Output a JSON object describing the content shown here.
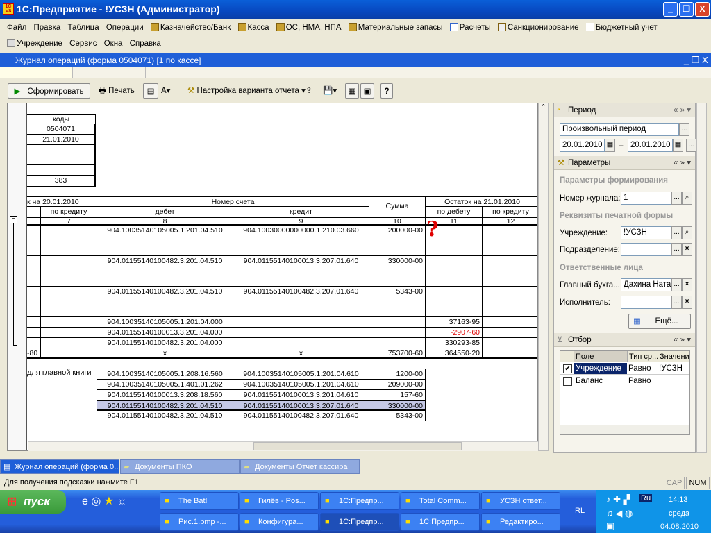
{
  "window": {
    "title": "1С:Предприятие - !УСЗН (Администратор)",
    "minimize": "_",
    "restore": "❐",
    "close": "X"
  },
  "menu": {
    "row1": [
      "Файл",
      "Правка",
      "Таблица",
      "Операции",
      "Казначейство/Банк",
      "Касса",
      "ОС, НМА, НПА",
      "Материальные запасы",
      "Расчеты",
      "Санкционирование",
      "Бюджетный учет"
    ],
    "row2": [
      "Учреждение",
      "Сервис",
      "Окна",
      "Справка"
    ]
  },
  "inner_window": {
    "title": "Журнал операций (форма 0504071) [1 по кассе]"
  },
  "toolbar": {
    "generate": "Сформировать",
    "print": "Печать",
    "variant_settings": "Настройка варианта отчета",
    "help": "?"
  },
  "report": {
    "codes": {
      "header": "коды",
      "values": [
        "0504071",
        "21.01.2010",
        "",
        "",
        "383"
      ]
    },
    "headers": {
      "balance_start": "к на 20.01.2010",
      "account_number": "Номер счета",
      "sum": "Сумма",
      "balance_end": "Остаток на 21.01.2010",
      "sub": [
        "по кредиту",
        "дебет",
        "кредит",
        "по дебету",
        "по кредиту"
      ],
      "numbers": [
        "7",
        "8",
        "9",
        "10",
        "11",
        "12"
      ]
    },
    "rows": [
      {
        "debit": "904.10035140105005.1.201.04.510",
        "credit": "904.10030000000000.1.210.03.660",
        "sum": "200000-00",
        "bal_debit": ""
      },
      {
        "debit": "904.01155140100482.3.201.04.510",
        "credit": "904.01155140100013.3.207.01.640",
        "sum": "330000-00",
        "bal_debit": ""
      },
      {
        "debit": "904.01155140100482.3.201.04.510",
        "credit": "904.01155140100482.3.207.01.640",
        "sum": "5343-00",
        "bal_debit": ""
      },
      {
        "debit": "904.10035140105005.1.201.04.000",
        "credit": "",
        "sum": "",
        "bal_debit": "37163-95"
      },
      {
        "debit": "904.01155140100013.3.201.04.000",
        "credit": "",
        "sum": "",
        "bal_debit": "-2907-60"
      },
      {
        "debit": "904.01155140100482.3.201.04.000",
        "credit": "",
        "sum": "",
        "bal_debit": "330293-85"
      }
    ],
    "totals": {
      "left": "-80",
      "debit": "x",
      "credit": "x",
      "sum": "753700-60",
      "bal_debit": "364550-20"
    },
    "annotation": "?",
    "ledger_label": "для главной книги",
    "ledger_rows": [
      {
        "debit": "904.10035140105005.1.208.16.560",
        "credit": "904.10035140105005.1.201.04.610",
        "sum": "1200-00"
      },
      {
        "debit": "904.10035140105005.1.401.01.262",
        "credit": "904.10035140105005.1.201.04.610",
        "sum": "209000-00"
      },
      {
        "debit": "904.01155140100013.3.208.18.560",
        "credit": "904.01155140100013.3.201.04.610",
        "sum": "157-60"
      },
      {
        "debit": "904.01155140100482.3.201.04.510",
        "credit": "904.01155140100013.3.207.01.640",
        "sum": "330000-00",
        "selected": true
      },
      {
        "debit": "904.01155140100482.3.201.04.510",
        "credit": "904.01155140100482.3.207.01.640",
        "sum": "5343-00"
      }
    ]
  },
  "panel": {
    "period": {
      "title": "Период",
      "type": "Произвольный период",
      "from": "20.01.2010",
      "to": "20.01.2010",
      "dash": "–"
    },
    "params": {
      "title": "Параметры",
      "group1": "Параметры формирования",
      "journal_label": "Номер журнала:",
      "journal_value": "1",
      "group2": "Реквизиты печатной формы",
      "org_label": "Учреждение:",
      "org_value": "!УСЗН",
      "dept_label": "Подразделение:",
      "dept_value": "",
      "group3": "Ответственные лица",
      "chief_label": "Главный бухга...",
      "chief_value": "Дахина Ната...",
      "exec_label": "Исполнитель:",
      "exec_value": "",
      "more": "Ещё..."
    },
    "filter": {
      "title": "Отбор",
      "columns": [
        "Поле",
        "Тип ср...",
        "Значение"
      ],
      "rows": [
        {
          "checked": true,
          "field": "Учреждение",
          "type": "Равно",
          "value": "!УСЗН"
        },
        {
          "checked": false,
          "field": "Баланс",
          "type": "Равно",
          "value": ""
        }
      ]
    }
  },
  "window_tabs": [
    "Журнал операций (форма 0...",
    "Документы ПКО",
    "Документы Отчет кассира"
  ],
  "status": {
    "hint": "Для получения подсказки нажмите F1",
    "cap": "CAP",
    "num": "NUM"
  },
  "taskbar": {
    "start": "пуск",
    "row1": [
      "The Bat!",
      "Гилёв - Pos...",
      "1С:Предпр...",
      "Total Comm...",
      "УСЗН ответ..."
    ],
    "row2": [
      "Рис.1.bmp -...",
      "Конфигура...",
      "1С:Предпр...",
      "1С:Предпр...",
      "Редактиро..."
    ],
    "lang": "RL",
    "tray_lang": "Ru",
    "time": "14:13",
    "day": "среда",
    "date": "04.08.2010"
  },
  "colors": {
    "title_blue": "#0a5fd8",
    "negative": "#e00000",
    "selected_row": "#c5c8e6",
    "annotation": "#e00000"
  }
}
